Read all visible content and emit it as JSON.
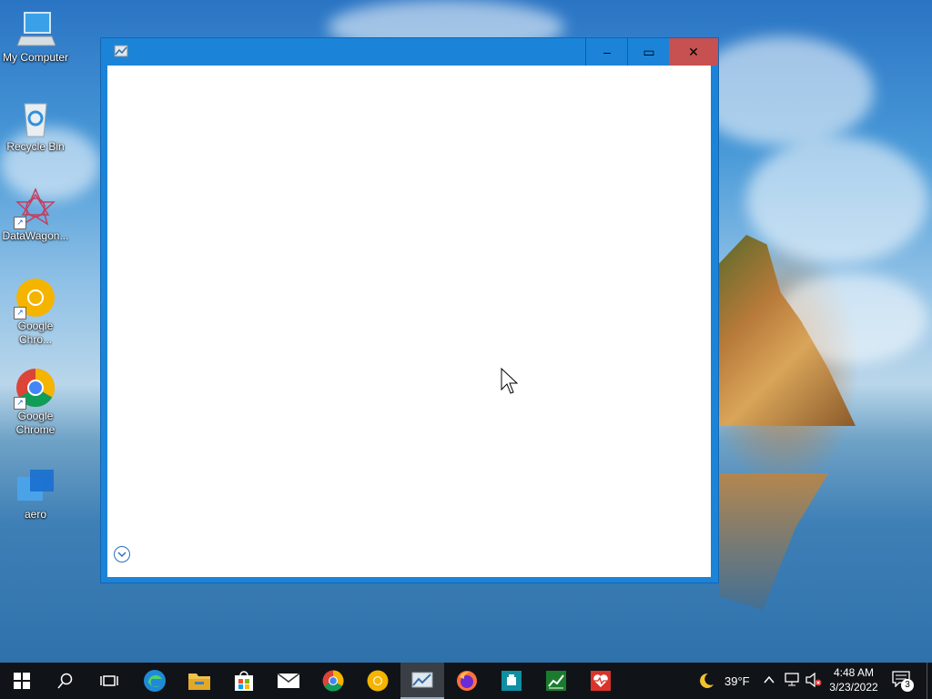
{
  "desktop": {
    "icons": [
      {
        "label_line1": "My Computer",
        "label_line2": "",
        "icon": "computer-icon"
      },
      {
        "label_line1": "Recycle Bin",
        "label_line2": "",
        "icon": "recycle-bin-icon"
      },
      {
        "label_line1": "DataWagon...",
        "label_line2": "",
        "icon": "datawagon-icon"
      },
      {
        "label_line1": "Google",
        "label_line2": "Chro...",
        "icon": "chrome-canary-icon"
      },
      {
        "label_line1": "Google",
        "label_line2": "Chrome",
        "icon": "chrome-icon"
      },
      {
        "label_line1": "aero",
        "label_line2": "",
        "icon": "aero-icon"
      }
    ]
  },
  "window": {
    "title": "",
    "minimize_glyph": "‒",
    "maximize_glyph": "▭",
    "close_glyph": "✕"
  },
  "taskbar": {
    "start_icon": "windows-start-icon",
    "items": [
      "search-icon",
      "task-view-icon",
      "edge-icon",
      "file-explorer-icon",
      "store-icon",
      "mail-icon",
      "chrome-icon",
      "chrome-canary-icon",
      "photo-app-icon",
      "firefox-icon",
      "teal-app-icon",
      "stock-chart-icon",
      "health-app-icon"
    ],
    "weather_temp": "39°F",
    "time": "4:48 AM",
    "date": "3/23/2022",
    "notification_count": "3"
  },
  "colors": {
    "window_frame": "#1b84d8",
    "close_button": "#c75050",
    "taskbar": "#101418"
  }
}
